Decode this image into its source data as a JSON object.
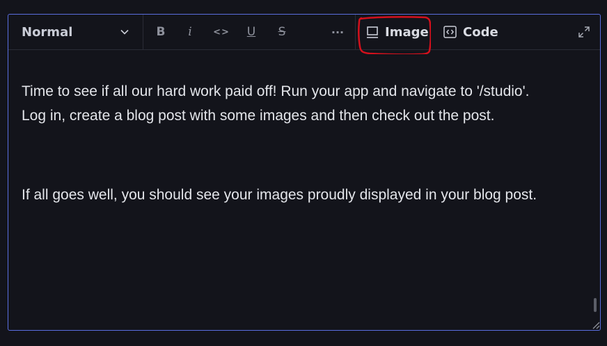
{
  "toolbar": {
    "block_style": "Normal",
    "image_label": "Image",
    "code_label": "Code"
  },
  "icons": {
    "bold": "B",
    "italic": "i",
    "inline_code": "<>",
    "underline": "U",
    "strikethrough": "S",
    "more": "···"
  },
  "content": {
    "paragraphs": [
      "Time to see if all our hard work paid off! Run your app and navigate to '/studio'. Log in, create a blog post with some images and then check out the post.",
      "If all goes well, you should see your images proudly displayed in your blog post."
    ]
  },
  "colors": {
    "background": "#13141b",
    "focus_border": "#5a6ee0",
    "annotation": "#d4101c"
  }
}
